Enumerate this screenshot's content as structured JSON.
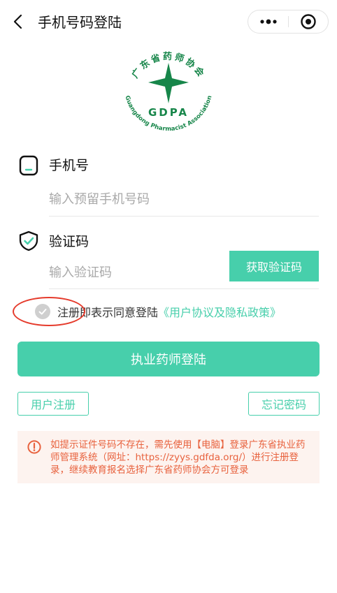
{
  "nav": {
    "title": "手机号码登陆",
    "back_icon": "chevron-left-icon",
    "more_icon": "more-dots-icon",
    "close_icon": "target-circle-icon"
  },
  "logo": {
    "arc_top": "广东省药师协会",
    "acronym": "GDPA",
    "arc_bottom": "Guangdong Pharmacist Association",
    "color": "#17864a"
  },
  "phone": {
    "label": "手机号",
    "icon": "phone-icon",
    "placeholder": "输入预留手机号码"
  },
  "code": {
    "label": "验证码",
    "icon": "shield-check-icon",
    "placeholder": "输入验证码",
    "button": "获取验证码"
  },
  "agreement": {
    "text": "注册即表示同意登陆",
    "link": "《用户协议及隐私政策》",
    "checked": false
  },
  "login_button": "执业药师登陆",
  "register_button": "用户注册",
  "forgot_button": "忘记密码",
  "notice": {
    "icon": "exclamation-circle-icon",
    "text": "如提示证件号码不存在，需先使用【电脑】登录广东省执业药师管理系统（网址：https://zyys.gdfda.org/）进行注册登录，继续教育报名选择广东省药师协会方可登录"
  },
  "colors": {
    "accent": "#47cfab",
    "warning": "#e8623e",
    "annotation": "#e53b2c"
  }
}
